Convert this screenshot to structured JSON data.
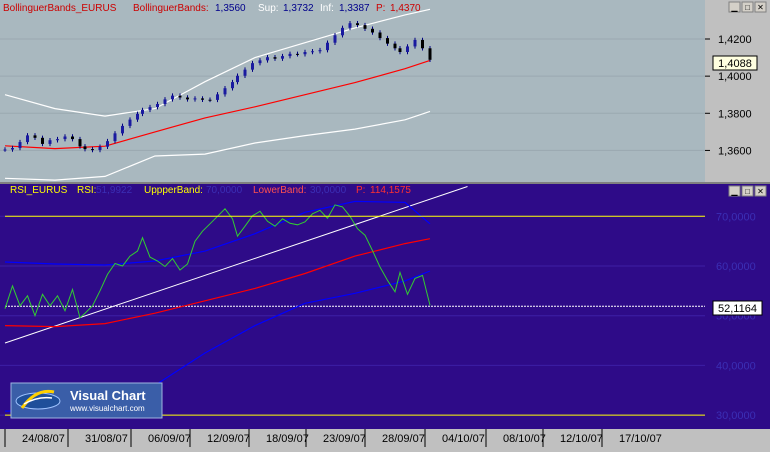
{
  "top_panel": {
    "series_label": "BollinguerBands_EURUS",
    "indicator_label": "BollinguerBands:",
    "indicator_value": "1,3560",
    "sup_label": "Sup:",
    "sup_value": "1,3732",
    "inf_label": "Inf:",
    "inf_value": "1,3387",
    "p_label": "P:",
    "p_value": "1,4370",
    "colors": {
      "background": "#a9b8bf",
      "price": "#000080",
      "middle": "#ff0000",
      "band": "#ffffff",
      "label_red": "#cc0000",
      "label_blue": "#00008b"
    }
  },
  "bottom_panel": {
    "series_label": "RSI_EURUS",
    "rsi_label": "RSI:",
    "rsi_value": "51,9922",
    "upper_label": "UppperBand:",
    "upper_value": "70,0000",
    "lower_label": "LowerBand:",
    "lower_value": "30,0000",
    "p_label": "P:",
    "p_value": "114,1575",
    "colors": {
      "background": "#2e0b88",
      "rsi": "#32cd32",
      "upper": "#ffff00",
      "lower": "#ffff00",
      "avg": "#ff0000",
      "band": "#0000ff",
      "trend": "#ffffff",
      "ref": "#ffffff"
    }
  },
  "window_buttons": {
    "minimize": "▁",
    "maximize": "□",
    "close": "✕"
  },
  "watermark": {
    "brand": "Visual Chart",
    "url": "www.visualchart.com"
  },
  "x_axis_labels": [
    "24/08/07",
    "31/08/07",
    "06/09/07",
    "12/09/07",
    "18/09/07",
    "23/09/07",
    "28/09/07",
    "04/10/07",
    "08/10/07",
    "12/10/07",
    "17/10/07"
  ],
  "chart_data": [
    {
      "type": "candlestick",
      "title": "BollinguerBands_EURUS",
      "y_ticks": [
        "1,4200",
        "1,4000",
        "1,3800",
        "1,3600"
      ],
      "ylim": [
        1.343,
        1.441
      ],
      "last_price_label": "1,4088",
      "series": [
        {
          "name": "Price",
          "x": [
            0,
            3,
            6,
            9,
            12,
            15,
            18,
            21,
            24,
            27,
            30,
            32,
            35,
            38,
            41,
            44,
            47,
            50,
            53,
            55,
            58,
            61,
            64,
            67,
            70,
            73,
            76,
            79,
            82,
            85,
            88,
            91,
            93,
            96,
            99,
            102,
            105,
            108,
            111,
            114,
            117,
            120,
            123,
            126,
            129,
            132,
            135,
            138,
            141,
            144,
            147,
            150,
            153,
            156,
            158,
            161,
            164,
            167,
            170
          ],
          "values": [
            1.3605,
            1.3613,
            1.3645,
            1.3681,
            1.3668,
            1.3635,
            1.3655,
            1.3661,
            1.3675,
            1.3661,
            1.3622,
            1.3607,
            1.3602,
            1.362,
            1.365,
            1.3692,
            1.3732,
            1.3766,
            1.3797,
            1.3818,
            1.3833,
            1.385,
            1.3875,
            1.3895,
            1.3885,
            1.3875,
            1.388,
            1.3873,
            1.3872,
            1.3902,
            1.3935,
            1.3968,
            1.4002,
            1.4035,
            1.407,
            1.4085,
            1.4102,
            1.4094,
            1.4108,
            1.412,
            1.4118,
            1.413,
            1.4134,
            1.414,
            1.418,
            1.422,
            1.426,
            1.4285,
            1.4275,
            1.4255,
            1.4235,
            1.4205,
            1.4175,
            1.415,
            1.413,
            1.416,
            1.4195,
            1.415,
            1.4088
          ]
        },
        {
          "name": "Middle",
          "x": [
            0,
            20,
            40,
            60,
            80,
            100,
            120,
            140,
            160,
            170
          ],
          "values": [
            1.3625,
            1.361,
            1.3623,
            1.37,
            1.3775,
            1.3835,
            1.39,
            1.3965,
            1.404,
            1.4085
          ]
        },
        {
          "name": "Upper",
          "x": [
            0,
            20,
            40,
            60,
            80,
            100,
            120,
            140,
            160,
            170
          ],
          "values": [
            1.39,
            1.3825,
            1.3785,
            1.3825,
            1.397,
            1.41,
            1.418,
            1.426,
            1.433,
            1.436
          ]
        },
        {
          "name": "Lower",
          "x": [
            0,
            20,
            40,
            60,
            80,
            100,
            120,
            140,
            160,
            170
          ],
          "values": [
            1.345,
            1.344,
            1.346,
            1.357,
            1.358,
            1.364,
            1.368,
            1.3715,
            1.3765,
            1.381
          ]
        }
      ]
    },
    {
      "type": "line",
      "title": "RSI_EURUS",
      "y_ticks": [
        "70,0000",
        "60,0000",
        "50,0000",
        "40,0000",
        "30,0000"
      ],
      "ylim": [
        27.2,
        76.5
      ],
      "last_value_label": "52,1164",
      "series": [
        {
          "name": "RSI",
          "x": [
            0,
            3,
            6,
            9,
            12,
            15,
            18,
            21,
            24,
            27,
            30,
            32,
            35,
            38,
            41,
            44,
            47,
            50,
            53,
            55,
            58,
            61,
            64,
            67,
            70,
            73,
            76,
            79,
            82,
            85,
            88,
            91,
            93,
            96,
            99,
            102,
            105,
            108,
            111,
            114,
            117,
            120,
            123,
            126,
            129,
            132,
            135,
            138,
            141,
            144,
            147,
            150,
            153,
            156,
            158,
            161,
            164,
            167,
            170
          ],
          "values": [
            51.4,
            56.0,
            52.0,
            54.0,
            50.0,
            54.3,
            52.0,
            54.0,
            51.0,
            55.3,
            49.6,
            50.5,
            52.0,
            55.0,
            58.3,
            60.5,
            60.0,
            62.0,
            63.0,
            65.7,
            61.8,
            61.0,
            59.9,
            61.5,
            59.2,
            60.4,
            65.0,
            67.0,
            68.5,
            70.0,
            71.5,
            69.5,
            66.0,
            68.0,
            70.1,
            71.0,
            69.0,
            68.0,
            69.5,
            68.6,
            68.3,
            68.9,
            70.5,
            71.2,
            69.6,
            72.3,
            71.9,
            70.0,
            67.5,
            66.2,
            63.1,
            59.8,
            57.1,
            54.8,
            58.7,
            54.3,
            57.5,
            58.1,
            52.1
          ]
        },
        {
          "name": "UppperBand",
          "x": [
            0,
            170
          ],
          "values": [
            70,
            70
          ]
        },
        {
          "name": "LowerBand",
          "x": [
            0,
            170
          ],
          "values": [
            30,
            30
          ]
        },
        {
          "name": "Avg",
          "x": [
            0,
            20,
            40,
            60,
            80,
            100,
            120,
            140,
            160,
            170
          ],
          "values": [
            48.0,
            47.8,
            48.4,
            50.5,
            53.0,
            55.5,
            58.5,
            62.0,
            64.5,
            65.5
          ]
        },
        {
          "name": "BandUpper",
          "x": [
            0,
            20,
            40,
            60,
            80,
            100,
            120,
            140,
            160,
            170
          ],
          "values": [
            60.8,
            60.4,
            60.2,
            61.0,
            63.0,
            66.5,
            70.8,
            73.0,
            72.8,
            68.5
          ]
        },
        {
          "name": "BandLower",
          "x": [
            0,
            20,
            40,
            60,
            80,
            100,
            120,
            140,
            160,
            170
          ],
          "values": [
            30.8,
            31.0,
            32.5,
            36.0,
            42.5,
            48.0,
            52.5,
            54.5,
            57.0,
            59.0
          ]
        },
        {
          "name": "Trend",
          "x": [
            0,
            185
          ],
          "values": [
            44.5,
            76.0
          ]
        },
        {
          "name": "Ref",
          "x": [
            0,
            200
          ],
          "values": [
            51.9,
            51.9
          ]
        }
      ]
    }
  ]
}
